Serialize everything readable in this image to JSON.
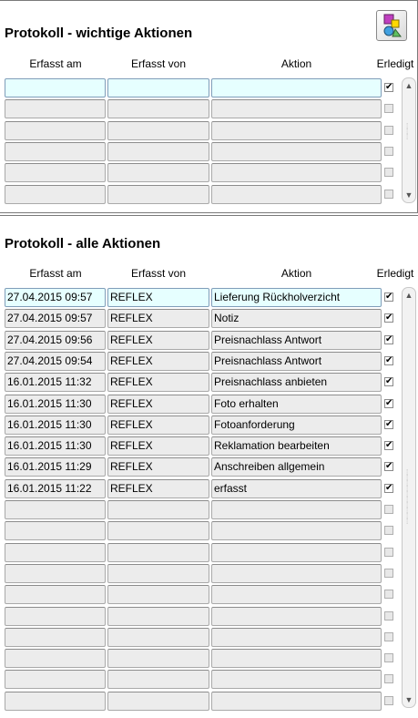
{
  "panel_important": {
    "title": "Protokoll - wichtige Aktionen",
    "headers": {
      "erfasst_am": "Erfasst am",
      "erfasst_von": "Erfasst von",
      "aktion": "Aktion",
      "erledigt": "Erledigt"
    },
    "rows": [
      {
        "date": "",
        "user": "",
        "action": "",
        "done": true
      },
      {
        "date": "",
        "user": "",
        "action": "",
        "done": false
      },
      {
        "date": "",
        "user": "",
        "action": "",
        "done": false
      },
      {
        "date": "",
        "user": "",
        "action": "",
        "done": false
      },
      {
        "date": "",
        "user": "",
        "action": "",
        "done": false
      },
      {
        "date": "",
        "user": "",
        "action": "",
        "done": false
      }
    ]
  },
  "panel_all": {
    "title": "Protokoll - alle Aktionen",
    "headers": {
      "erfasst_am": "Erfasst am",
      "erfasst_von": "Erfasst von",
      "aktion": "Aktion",
      "erledigt": "Erledigt"
    },
    "rows": [
      {
        "date": "27.04.2015 09:57",
        "user": "REFLEX",
        "action": "Lieferung Rückholverzicht",
        "done": true
      },
      {
        "date": "27.04.2015 09:57",
        "user": "REFLEX",
        "action": "Notiz",
        "done": true
      },
      {
        "date": "27.04.2015 09:56",
        "user": "REFLEX",
        "action": "Preisnachlass Antwort",
        "done": true
      },
      {
        "date": "27.04.2015 09:54",
        "user": "REFLEX",
        "action": "Preisnachlass Antwort",
        "done": true
      },
      {
        "date": "16.01.2015 11:32",
        "user": "REFLEX",
        "action": "Preisnachlass anbieten",
        "done": true
      },
      {
        "date": "16.01.2015 11:30",
        "user": "REFLEX",
        "action": "Foto erhalten",
        "done": true
      },
      {
        "date": "16.01.2015 11:30",
        "user": "REFLEX",
        "action": "Fotoanforderung",
        "done": true
      },
      {
        "date": "16.01.2015 11:30",
        "user": "REFLEX",
        "action": "Reklamation bearbeiten",
        "done": true
      },
      {
        "date": "16.01.2015 11:29",
        "user": "REFLEX",
        "action": "Anschreiben allgemein",
        "done": true
      },
      {
        "date": "16.01.2015 11:22",
        "user": "REFLEX",
        "action": "erfasst",
        "done": true
      },
      {
        "date": "",
        "user": "",
        "action": "",
        "done": false
      },
      {
        "date": "",
        "user": "",
        "action": "",
        "done": false
      },
      {
        "date": "",
        "user": "",
        "action": "",
        "done": false
      },
      {
        "date": "",
        "user": "",
        "action": "",
        "done": false
      },
      {
        "date": "",
        "user": "",
        "action": "",
        "done": false
      },
      {
        "date": "",
        "user": "",
        "action": "",
        "done": false
      },
      {
        "date": "",
        "user": "",
        "action": "",
        "done": false
      },
      {
        "date": "",
        "user": "",
        "action": "",
        "done": false
      },
      {
        "date": "",
        "user": "",
        "action": "",
        "done": false
      },
      {
        "date": "",
        "user": "",
        "action": "",
        "done": false
      }
    ]
  },
  "icons": {
    "logo": "app-logo-icon",
    "scroll_up": "scroll-up-icon",
    "scroll_down": "scroll-down-icon",
    "checkbox": "checkbox-icon"
  },
  "colors": {
    "active_row": "#e6ffff",
    "inactive_cell": "#ececec"
  }
}
